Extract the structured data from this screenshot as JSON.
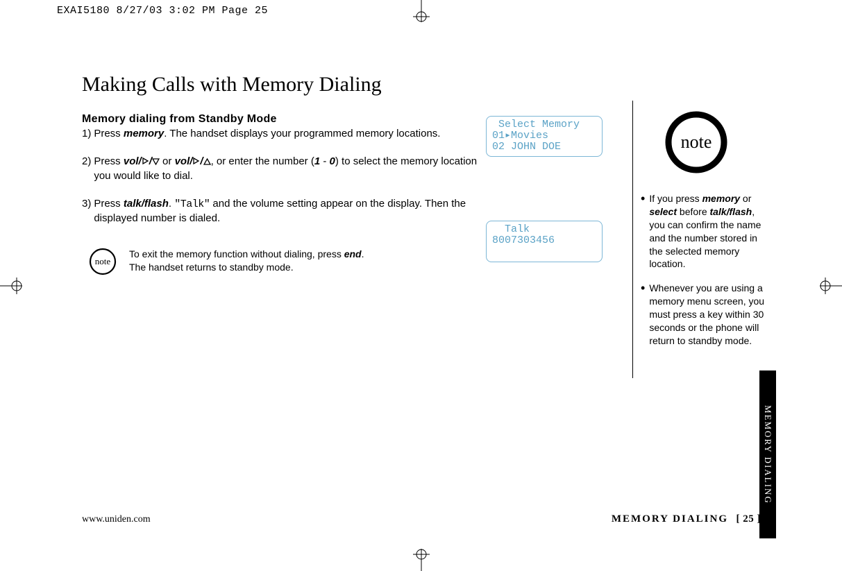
{
  "header": {
    "slug": "EXAI5180  8/27/03 3:02 PM  Page 25"
  },
  "title": "Making Calls with Memory Dialing",
  "subhead": "Memory dialing from Standby Mode",
  "steps": {
    "s1n": "1)",
    "s1a": "Press ",
    "s1_kw": "memory",
    "s1b": ". The handset displays your programmed memory locations.",
    "s2n": "2)",
    "s2a": "Press ",
    "s2_kw1": "vol/",
    "s2_or": " or ",
    "s2_kw2": "vol/",
    "s2b": ", or enter the number (",
    "s2_n1": "1",
    "s2_dash": " - ",
    "s2_n0": "0",
    "s2c": ") to select the memory location you would like to dial.",
    "s3n": "3)",
    "s3a": "Press ",
    "s3_kw": "talk/flash",
    "s3b": ". ",
    "s3_mono": "\"Talk\"",
    "s3c": " and the volume setting appear on the display. Then the displayed number is dialed."
  },
  "inline_note": {
    "a": "To exit the memory function without dialing, press ",
    "kw": "end",
    "b": ".",
    "l2": "The handset returns to standby mode."
  },
  "lcd1": {
    "l1": " Select Memory",
    "l2": "01▸Movies",
    "l3": "02 JOHN DOE"
  },
  "lcd2": {
    "l1": "  Talk",
    "l2": "8007303456"
  },
  "sidebar": {
    "n1a": "If you press ",
    "n1_kw1": "memory",
    "n1b": " or ",
    "n1_kw2": "select",
    "n1c": " before ",
    "n1_kw3": "talk/flash",
    "n1d": ", you can confirm the name and the number stored in the selected memory location.",
    "n2": "Whenever you are using a memory menu screen, you must press a key within 30 seconds or the phone will return to standby mode."
  },
  "footer": {
    "left": "www.uniden.com",
    "right_label": "MEMORY DIALING",
    "right_page": "[ 25 ]"
  },
  "tab": "MEMORY DIALING",
  "note_label": "note"
}
